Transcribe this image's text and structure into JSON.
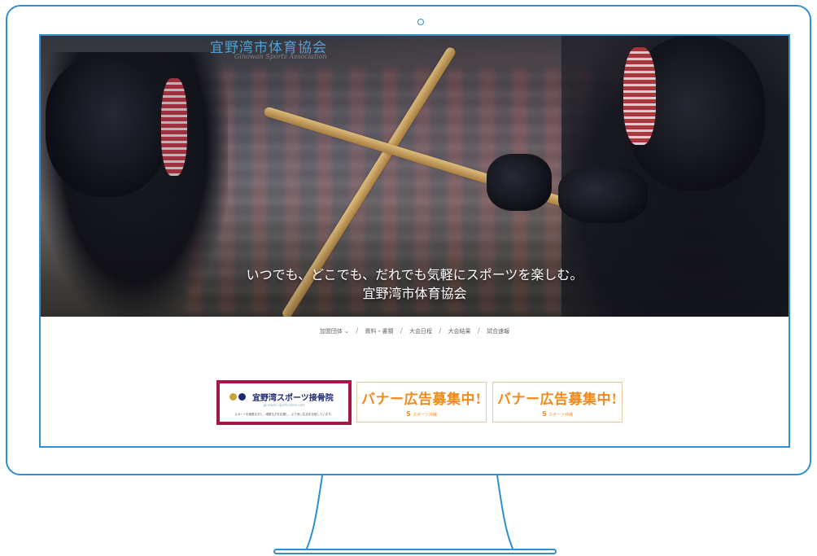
{
  "site": {
    "title": "宜野湾市体育協会",
    "subtitle": "Ginowan Sports Association"
  },
  "hero": {
    "tagline": "いつでも、どこでも、だれでも気軽にスポーツを楽しむ。",
    "tagline_org": "宜野湾市体育協会"
  },
  "nav": {
    "items": [
      {
        "label": "加盟団体 ⌄"
      },
      {
        "label": "資料・書類"
      },
      {
        "label": "大会日程"
      },
      {
        "label": "大会結果"
      },
      {
        "label": "試合速報"
      }
    ],
    "separator": "/"
  },
  "banners": [
    {
      "title": "宜野湾スポーツ接骨院",
      "subtitle": "ginowan sports bone sett",
      "note": "スポーツを頑張る方と、頑張る方を応援し、より良い生活を目指しています。",
      "dot_colors": [
        "#c9a23a",
        "#1e2a70"
      ]
    },
    {
      "title": "バナー広告募集中!",
      "logo": "スポーツ沖縄",
      "logo_mark": "S"
    },
    {
      "title": "バナー広告募集中!",
      "logo": "スポーツ沖縄",
      "logo_mark": "S"
    }
  ],
  "colors": {
    "frame": "#2f8fd0",
    "highlight_border": "#a3174a",
    "banner_accent": "#f08a1c",
    "title_blue": "#4fa0d6"
  }
}
